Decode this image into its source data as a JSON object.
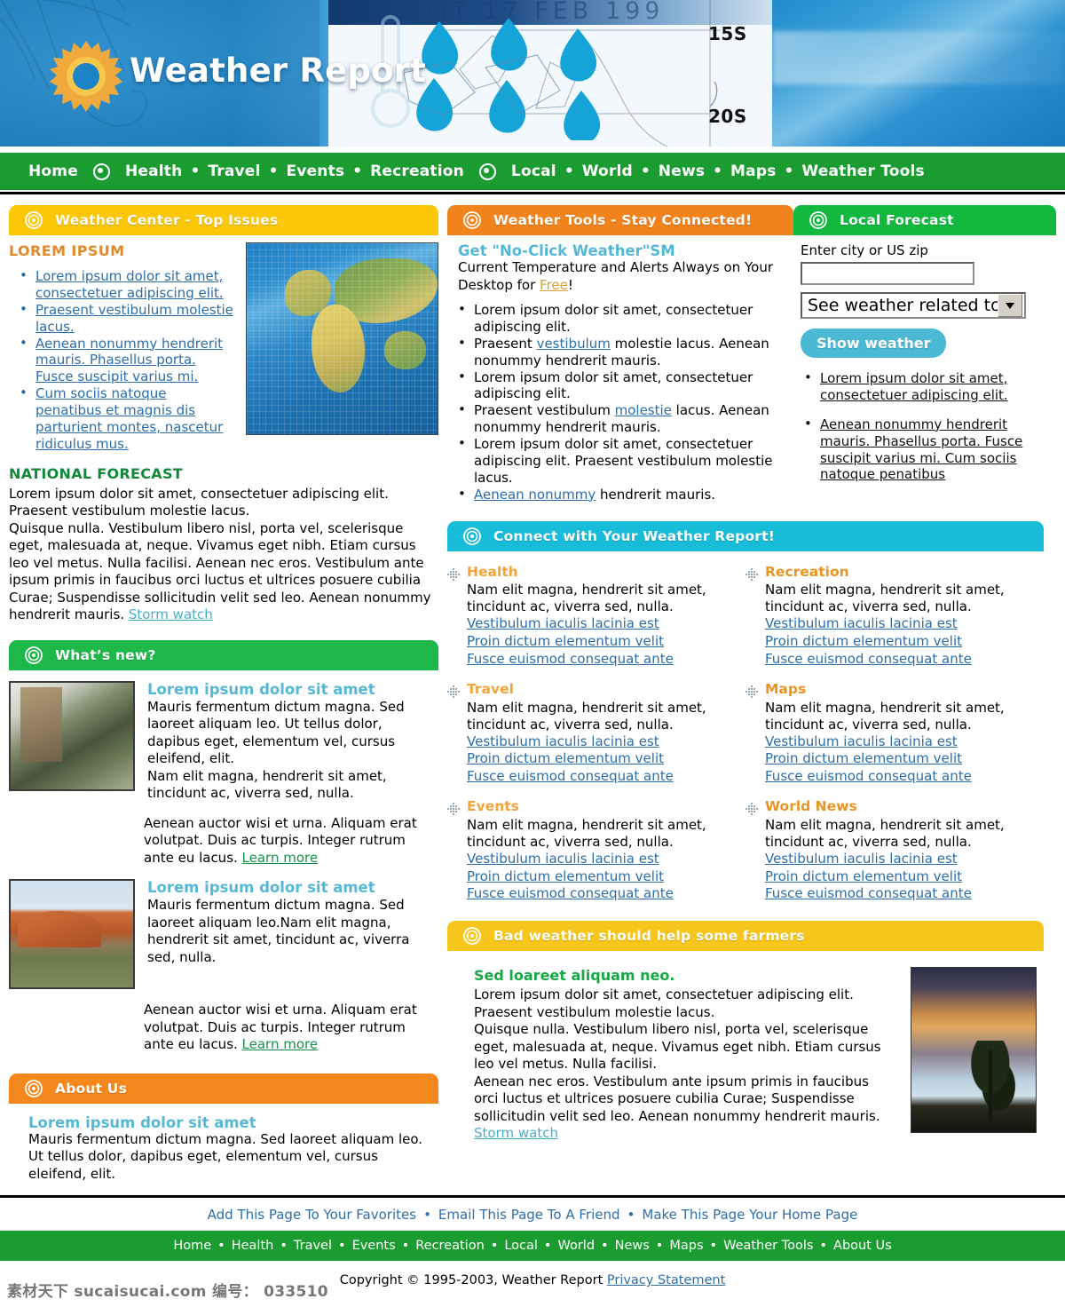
{
  "banner": {
    "title": "Weather Report",
    "chart_date": "GMT 17 FEB 199",
    "lat_15": "15S",
    "lat_20": "20S",
    "sun_icon": "sun-icon",
    "umbrella_icon": "umbrella-icon",
    "thermometer_icon": "thermometer-icon",
    "raindrop_icon": "raindrop-icon"
  },
  "nav": {
    "items": [
      {
        "label": "Home"
      },
      {
        "label": "Health"
      },
      {
        "label": "Travel"
      },
      {
        "label": "Events"
      },
      {
        "label": "Recreation"
      },
      {
        "label": "Local"
      },
      {
        "label": "World"
      },
      {
        "label": "News"
      },
      {
        "label": "Maps"
      },
      {
        "label": "Weather Tools"
      }
    ],
    "separator": "•"
  },
  "weather_center": {
    "header": "Weather Center - Top Issues",
    "subhead": "LOREM IPSUM",
    "bullets": [
      "Lorem ipsum dolor sit amet, consectetuer adipiscing elit.",
      "Praesent vestibulum molestie lacus.",
      "Aenean nonummy hendrerit mauris. Phasellus porta. Fusce suscipit varius mi.",
      "Cum sociis natoque penatibus et magnis dis parturient montes, nascetur ridiculus mus."
    ],
    "national_forecast_head": "NATIONAL FORECAST",
    "national_forecast_body": "Lorem ipsum dolor sit amet, consectetuer adipiscing elit. Praesent vestibulum molestie lacus.",
    "national_forecast_body2": "Quisque nulla. Vestibulum libero nisl, porta vel, scelerisque eget, malesuada at, neque. Vivamus eget nibh. Etiam cursus leo vel metus. Nulla facilisi. Aenean nec eros. Vestibulum ante ipsum primis in faucibus orci luctus et ultrices posuere cubilia Curae; Suspendisse sollicitudin velit sed leo.  Aenean nonummy hendrerit mauris. ",
    "storm_watch_link": "Storm watch",
    "map_image": "world-map-image"
  },
  "whats_new": {
    "header": "What’s new?",
    "items": [
      {
        "title": "Lorem ipsum dolor sit amet",
        "body1": "Mauris fermentum dictum magna. Sed laoreet aliquam leo. Ut tellus dolor, dapibus eget, elementum vel, cursus eleifend, elit.",
        "body2": "Nam elit magna, hendrerit sit amet, tincidunt ac, viverra sed, nulla.",
        "body3": "Aenean auctor wisi et urna. Aliquam erat volutpat. Duis ac turpis. Integer rutrum ante eu lacus. ",
        "link": "Learn more",
        "thumb": "snowy-trees-image"
      },
      {
        "title": "Lorem ipsum dolor sit amet",
        "body1": "Mauris fermentum dictum magna. Sed laoreet aliquam leo.Nam elit magna, hendrerit sit amet, tincidunt ac, viverra sed, nulla.",
        "body2": "",
        "body3": "Aenean auctor wisi et urna. Aliquam erat volutpat. Duis ac turpis. Integer rutrum ante eu lacus. ",
        "link": "Learn more",
        "thumb": "red-rock-desert-image"
      }
    ]
  },
  "about_us": {
    "header": "About Us",
    "title": "Lorem ipsum dolor sit amet",
    "body": "Mauris fermentum dictum magna. Sed laoreet aliquam leo. Ut tellus dolor, dapibus eget, elementum vel, cursus eleifend, elit."
  },
  "weather_tools": {
    "header": "Weather Tools - Stay Connected!",
    "title": "Get \"No-Click Weather\"SM",
    "lead_pre": "Current Temperature and Alerts Always on Your Desktop for ",
    "lead_link": "Free",
    "lead_post": "!",
    "bullets": [
      {
        "pre": "Lorem ipsum dolor sit amet, consectetuer adipiscing elit.",
        "link": "",
        "post": ""
      },
      {
        "pre": "Praesent ",
        "link": "vestibulum",
        "post": " molestie lacus. Aenean nonummy hendrerit mauris."
      },
      {
        "pre": "Lorem ipsum dolor sit amet, consectetuer adipiscing elit.",
        "link": "",
        "post": ""
      },
      {
        "pre": "Praesent vestibulum ",
        "link": "molestie",
        "post": " lacus. Aenean nonummy hendrerit mauris."
      },
      {
        "pre": "Lorem ipsum dolor sit amet, consectetuer adipiscing elit. Praesent vestibulum molestie lacus.",
        "link": "",
        "post": ""
      },
      {
        "pre": "",
        "link": "Aenean nonummy",
        "post": " hendrerit mauris."
      }
    ]
  },
  "local_forecast": {
    "header": "Local Forecast",
    "field_label": "Enter city or US zip",
    "input_value": "",
    "input_placeholder": "",
    "select_value": "See weather related to ...",
    "select_options": [
      "See weather related to ..."
    ],
    "button_label": "Show weather",
    "bullets": [
      "Lorem ipsum dolor sit amet, consectetuer adipiscing elit. ",
      "Aenean nonummy hendrerit mauris. Phasellus porta. Fusce suscipit varius mi. Cum sociis natoque penatibus"
    ]
  },
  "connect": {
    "header": "Connect with Your Weather Report!",
    "categories": [
      {
        "title": "Health",
        "body": "Nam elit magna, hendrerit sit amet, tincidunt ac, viverra sed, nulla.",
        "links": [
          "Vestibulum iaculis lacinia est",
          "Proin dictum elementum velit",
          "Fusce euismod consequat ante "
        ]
      },
      {
        "title": "Recreation",
        "body": "Nam elit magna, hendrerit sit amet, tincidunt ac, viverra sed, nulla.",
        "links": [
          "Vestibulum iaculis lacinia est",
          "Proin dictum elementum velit",
          "Fusce euismod consequat ante "
        ]
      },
      {
        "title": "Travel",
        "body": "Nam elit magna, hendrerit sit amet, tincidunt ac, viverra sed, nulla.",
        "links": [
          "Vestibulum iaculis lacinia est",
          "Proin dictum elementum velit",
          "Fusce euismod consequat ante "
        ]
      },
      {
        "title": "Maps",
        "body": "Nam elit magna, hendrerit sit amet, tincidunt ac, viverra sed, nulla.",
        "links": [
          "Vestibulum iaculis lacinia est",
          "Proin dictum elementum velit",
          "Fusce euismod consequat ante "
        ]
      },
      {
        "title": "Events",
        "body": "Nam elit magna, hendrerit sit amet, tincidunt ac, viverra sed, nulla.",
        "links": [
          "Vestibulum iaculis lacinia est",
          "Proin dictum elementum velit",
          "Fusce euismod consequat ante "
        ]
      },
      {
        "title": "World News",
        "body": "Nam elit magna, hendrerit sit amet, tincidunt ac, viverra sed, nulla.",
        "links": [
          "Vestibulum iaculis lacinia est",
          "Proin dictum elementum velit",
          "Fusce euismod consequat ante "
        ]
      }
    ]
  },
  "farmers": {
    "header": "Bad weather should help some farmers",
    "title": "Sed loareet aliquam neo.",
    "p1": "Lorem ipsum dolor sit amet, consectetuer adipiscing elit. Praesent vestibulum molestie lacus.",
    "p2": "Quisque nulla. Vestibulum libero nisl, porta vel, scelerisque eget, malesuada at, neque. Vivamus eget nibh. Etiam cursus leo vel metus. Nulla facilisi.",
    "p3": "Aenean nec eros. Vestibulum ante ipsum primis in faucibus orci luctus et ultrices posuere cubilia Curae; Suspendisse sollicitudin velit sed leo. Aenean nonummy hendrerit mauris. ",
    "link": "Storm watch",
    "image": "sunset-tree-image"
  },
  "footer": {
    "utility_links": [
      "Add This Page To Your Favorites",
      "Email This Page To A Friend",
      "Make This Page Your Home Page"
    ],
    "nav_links": [
      "Home",
      "Health",
      "Travel",
      "Events",
      "Recreation",
      "Local",
      "World",
      "News",
      "Maps",
      "Weather Tools",
      "About Us"
    ],
    "separator": "•",
    "copyright": "Copyright © 1995-2003, Weather Report ",
    "privacy_link": "Privacy Statement",
    "watermark": "素材天下 sucaisucai.com  编号： 033510"
  },
  "colors": {
    "nav_green": "#1b9c31",
    "panel_yellow": "#fbc707",
    "panel_orange": "#f2821b",
    "panel_green": "#1db84a",
    "panel_cyan": "#17bcd8",
    "panel_gold": "#f7c61a",
    "button_cyan": "#4cb9d4",
    "link_blue": "#2b6ea8",
    "heading_orange": "#e08a2c",
    "heading_green": "#12883a",
    "heading_blue": "#55b8d4"
  }
}
